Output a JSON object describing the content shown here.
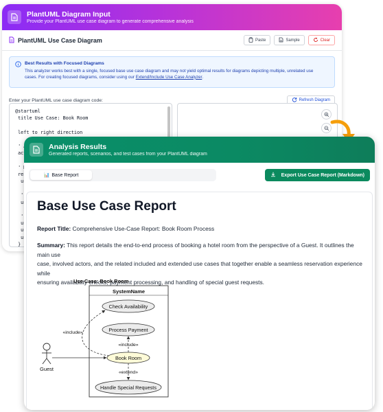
{
  "input_card": {
    "title": "PlantUML Diagram Input",
    "subtitle": "Provide your PlantUML use case diagram to generate comprehensive analysis",
    "section_title": "PlantUML Use Case Diagram",
    "buttons": {
      "paste": "Paste",
      "sample": "Sample",
      "clear": "Clear"
    },
    "info": {
      "title": "Best Results with Focused Diagrams",
      "line1": "This analyzer works best with a single, focused base use case diagram and may not yield optimal results for diagrams depicting multiple, unrelated use",
      "line2_prefix": "cases. For creating focused diagrams, consider using our ",
      "link": "Extend/Include Use Case Analyzer",
      "line2_suffix": "."
    },
    "code_label": "Enter your PlantUML use case diagram code:",
    "refresh_label": "Refresh Diagram",
    "code_lines": [
      "@startuml",
      " title Use Case: Book Room",
      "",
      " left to right direction",
      "",
      " ' Ac",
      " acto",
      "",
      " ' M",
      " rec",
      "  use",
      "",
      "  ' E",
      "  use",
      "",
      "  ' I",
      "  use",
      "  use",
      "  use",
      " }",
      "",
      " ' Re"
    ]
  },
  "results_card": {
    "title": "Analysis Results",
    "subtitle": "Generated reports, scenarios, and test cases from your PlantUML diagram",
    "tab_label": "Base Report",
    "tab_emoji": "📊",
    "export_label": "Export Use Case Report (Markdown)"
  },
  "report": {
    "heading": "Base Use Case Report",
    "title_label": "Report Title:",
    "title_value": "Comprehensive Use-Case Report: Book Room Process",
    "summary_label": "Summary:",
    "summary_line1": "This report details the end-to-end process of booking a hotel room from the perspective of a Guest. It outlines the main use",
    "summary_line2": "case, involved actors, and the related included and extended use cases that together enable a seamless reservation experience while",
    "summary_line3": "ensuring availability checks, payment processing, and handling of special guest requests."
  },
  "diagram": {
    "title": "Use Case: Book Room",
    "system_name": "SystemName",
    "actor": "Guest",
    "use_cases": [
      "Check Availability",
      "Process Payment",
      "Book Room",
      "Handle Special Requests"
    ],
    "include_label": "«include»",
    "extend_label": "«extend»"
  },
  "colors": {
    "input_header_start": "#8b2cf5",
    "input_header_end": "#e73fae",
    "results_header": "#0b8a63",
    "export_button": "#0b8a5e",
    "arrow": "#f59e0b",
    "main_use_case_fill": "#fefbd8"
  },
  "icons": [
    "document-icon",
    "paste-icon",
    "sample-icon",
    "clear-icon",
    "info-icon",
    "refresh-icon",
    "zoom-in-icon",
    "zoom-out-icon",
    "download-icon",
    "arrow-icon"
  ]
}
